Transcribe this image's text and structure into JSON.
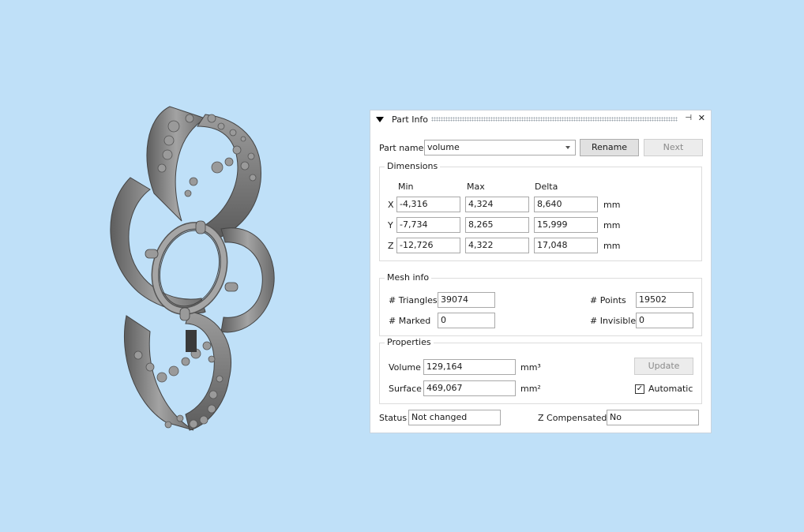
{
  "panel": {
    "title": "Part Info",
    "part_name_label": "Part name",
    "part_name_value": "volume",
    "rename_label": "Rename",
    "next_label": "Next"
  },
  "dimensions": {
    "title": "Dimensions",
    "col_min": "Min",
    "col_max": "Max",
    "col_delta": "Delta",
    "rows": [
      {
        "axis": "X",
        "min": "-4,316",
        "max": "4,324",
        "delta": "8,640",
        "unit": "mm"
      },
      {
        "axis": "Y",
        "min": "-7,734",
        "max": "8,265",
        "delta": "15,999",
        "unit": "mm"
      },
      {
        "axis": "Z",
        "min": "-12,726",
        "max": "4,322",
        "delta": "17,048",
        "unit": "mm"
      }
    ]
  },
  "mesh": {
    "title": "Mesh info",
    "triangles_label": "# Triangles",
    "triangles_value": "39074",
    "points_label": "# Points",
    "points_value": "19502",
    "marked_label": "# Marked",
    "marked_value": "0",
    "invisible_label": "# Invisible",
    "invisible_value": "0"
  },
  "properties": {
    "title": "Properties",
    "volume_label": "Volume",
    "volume_value": "129,164",
    "volume_unit": "mm³",
    "surface_label": "Surface",
    "surface_value": "469,067",
    "surface_unit": "mm²",
    "update_label": "Update",
    "automatic_label": "Automatic",
    "automatic_checked": true
  },
  "status": {
    "status_label": "Status",
    "status_value": "Not changed",
    "zcomp_label": "Z Compensated",
    "zcomp_value": "No"
  },
  "colors": {
    "background": "#bfe0f8",
    "model": "#8a8a8a"
  }
}
